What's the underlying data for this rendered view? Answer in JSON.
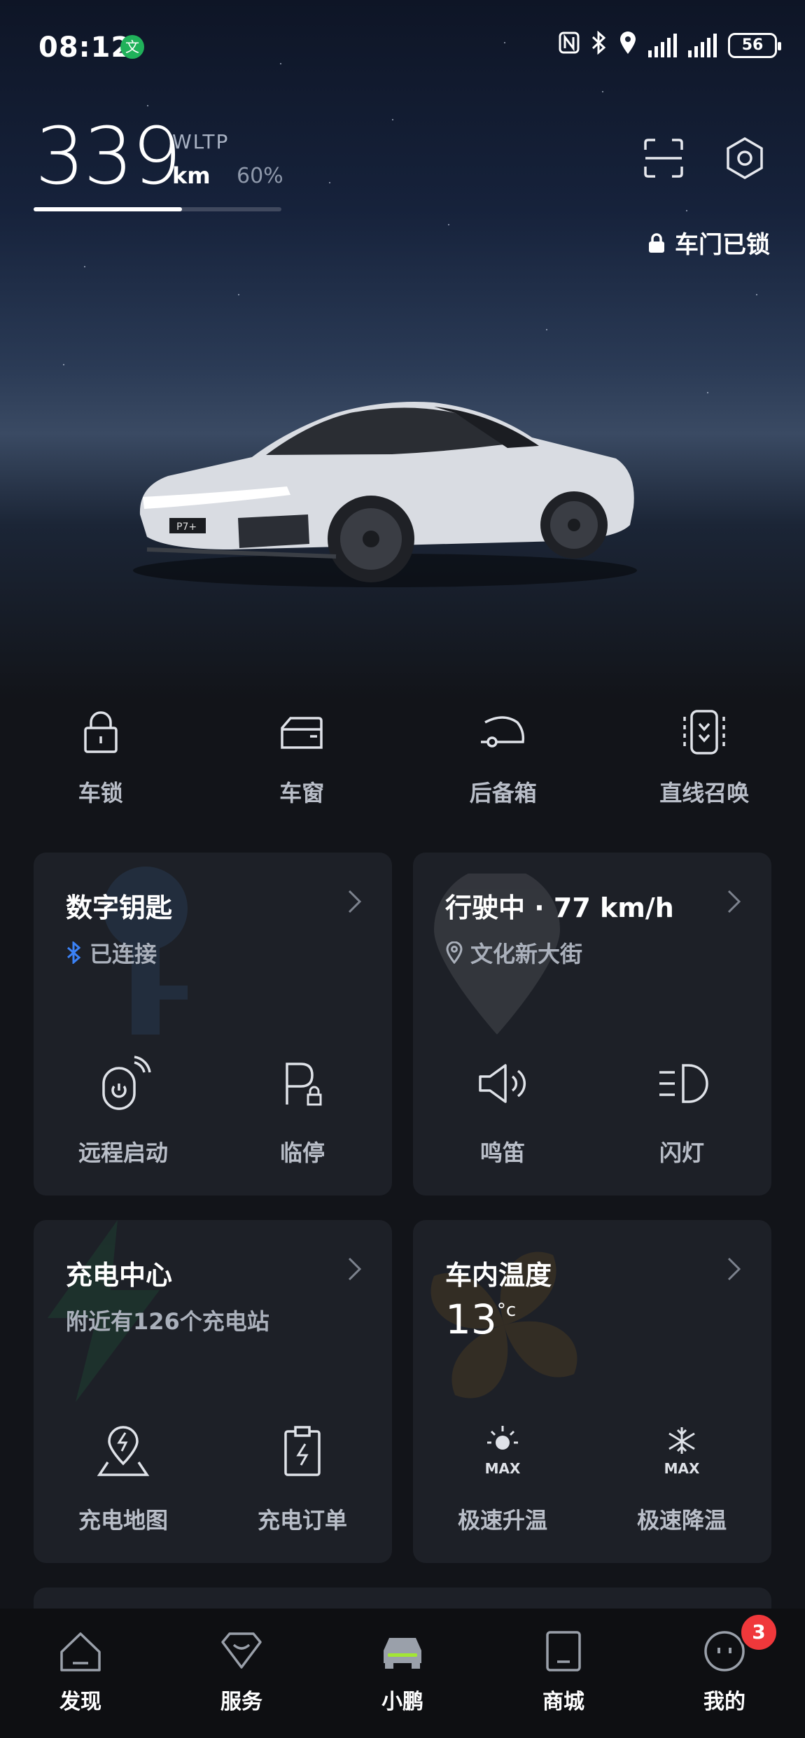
{
  "status_bar": {
    "time": "08:12",
    "battery": "56",
    "icons": [
      "wechat-icon",
      "nfc-icon",
      "bluetooth-icon",
      "location-icon",
      "signal-icon",
      "signal-icon",
      "battery-icon"
    ]
  },
  "range": {
    "value": "339",
    "standard": "WLTP",
    "unit": "km",
    "battery_percent_label": "60%",
    "battery_fraction": 0.6
  },
  "header": {
    "lock_status": "车门已锁"
  },
  "quick_controls": [
    {
      "label": "车锁",
      "icon": "lock-icon"
    },
    {
      "label": "车窗",
      "icon": "window-icon"
    },
    {
      "label": "后备箱",
      "icon": "trunk-icon"
    },
    {
      "label": "直线召唤",
      "icon": "summon-icon"
    }
  ],
  "cards": {
    "digital_key": {
      "title": "数字钥匙",
      "status": "已连接",
      "actions": [
        {
          "label": "远程启动",
          "icon": "remote-start-icon"
        },
        {
          "label": "临停",
          "icon": "temp-parking-icon"
        }
      ]
    },
    "driving": {
      "title": "行驶中 · 77 km/h",
      "location": "文化新大街",
      "actions": [
        {
          "label": "鸣笛",
          "icon": "horn-icon"
        },
        {
          "label": "闪灯",
          "icon": "flash-lights-icon"
        }
      ]
    },
    "charging": {
      "title": "充电中心",
      "subtitle": "附近有126个充电站",
      "actions": [
        {
          "label": "充电地图",
          "icon": "charging-map-icon"
        },
        {
          "label": "充电订单",
          "icon": "charging-order-icon"
        }
      ]
    },
    "climate": {
      "title": "车内温度",
      "temperature": "13",
      "unit": "°c",
      "actions": [
        {
          "label": "极速升温",
          "icon": "max-heat-icon",
          "tag": "MAX"
        },
        {
          "label": "极速降温",
          "icon": "max-cool-icon",
          "tag": "MAX"
        }
      ]
    }
  },
  "tabbar": {
    "tabs": [
      {
        "label": "发现",
        "icon": "discover-icon"
      },
      {
        "label": "服务",
        "icon": "service-icon"
      },
      {
        "label": "小鹏",
        "icon": "car-icon",
        "active": true
      },
      {
        "label": "商城",
        "icon": "mall-icon"
      },
      {
        "label": "我的",
        "icon": "profile-icon",
        "badge": "3"
      }
    ]
  },
  "colors": {
    "card_bg": "#1d2027",
    "accent_green": "#a3e635",
    "badge_red": "#f0383b",
    "bluetooth_blue": "#3b82f6"
  }
}
